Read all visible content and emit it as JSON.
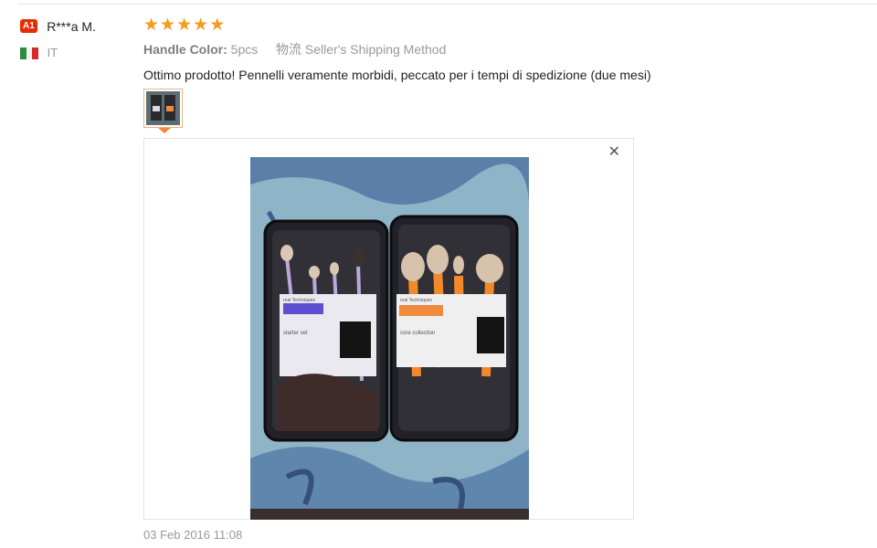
{
  "reviewer": {
    "level_badge": "A1",
    "name": "R***a M.",
    "country": "IT"
  },
  "review": {
    "rating": 5,
    "stars": [
      "★",
      "★",
      "★",
      "★",
      "★"
    ],
    "handle_label": "Handle Color:",
    "handle_value": "5pcs",
    "shipping_prefix": "物流",
    "shipping_value": "Seller's Shipping Method",
    "text": "Ottimo prodotto! Pennelli veramente morbidi, peccato per i tempi di spedizione (due mesi)",
    "date": "03 Feb 2016 11:08"
  },
  "viewer": {
    "close_label": "✕"
  },
  "photo": {
    "left_box_brand": "real Techniques",
    "right_box_brand": "real Techniques",
    "left_box_text": "starter set",
    "right_box_text": "core collection"
  },
  "colors": {
    "badge": "#e62e04",
    "star": "#f79b1a",
    "thumb_border": "#f0b082",
    "brand_orange": "#f08a3c"
  }
}
